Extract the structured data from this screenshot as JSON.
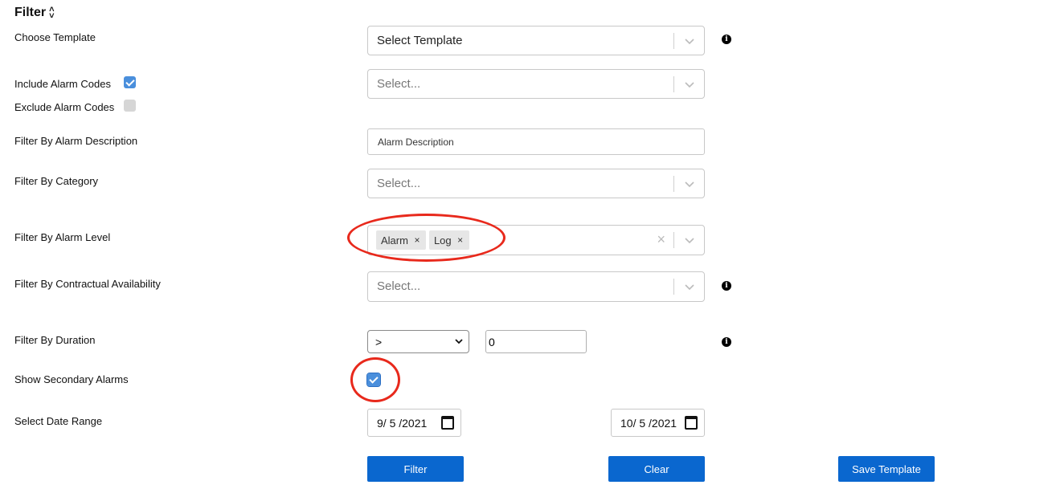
{
  "filter": {
    "title": "Filter",
    "collapse_icon": "chevron-collapse-icon"
  },
  "labels": {
    "choose_template": "Choose Template",
    "include_alarm_codes": "Include Alarm Codes",
    "exclude_alarm_codes": "Exclude Alarm Codes",
    "alarm_description": "Filter By Alarm Description",
    "category": "Filter By Category",
    "alarm_level": "Filter By Alarm Level",
    "contractual_availability": "Filter By Contractual Availability",
    "duration": "Filter By Duration",
    "secondary_alarms": "Show Secondary Alarms",
    "date_range": "Select Date Range"
  },
  "template_select": {
    "value": "Select Template"
  },
  "alarm_codes_select": {
    "placeholder": "Select..."
  },
  "alarm_description_input": {
    "placeholder": "Alarm Description"
  },
  "category_select": {
    "placeholder": "Select..."
  },
  "alarm_level_select": {
    "chips": [
      {
        "label": "Alarm",
        "remove": "×"
      },
      {
        "label": "Log",
        "remove": "×"
      }
    ],
    "clear": "×"
  },
  "contractual_select": {
    "placeholder": "Select..."
  },
  "duration": {
    "operator": ">",
    "value": "0"
  },
  "checkboxes": {
    "include_alarm_codes": true,
    "exclude_alarm_codes": false,
    "show_secondary_alarms": true
  },
  "date_range": {
    "start": "9/ 5 /2021",
    "end": "10/ 5 /2021"
  },
  "buttons": {
    "filter": "Filter",
    "clear": "Clear",
    "save_template": "Save Template"
  },
  "info_icon": "i",
  "colors": {
    "primary_button": "#0a67cf",
    "checkbox_checked": "#4a8fdc",
    "annotation_ring": "#e8291c"
  }
}
